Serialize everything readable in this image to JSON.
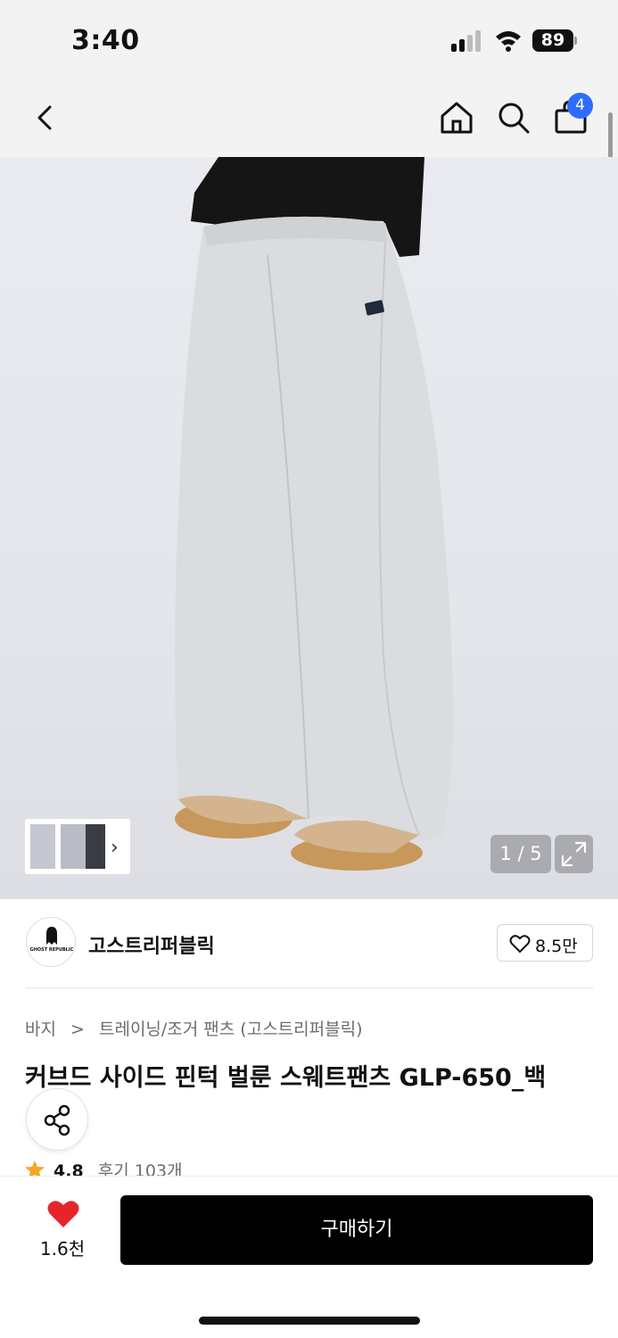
{
  "status_bar": {
    "time": "3:40",
    "battery": "89"
  },
  "nav": {
    "cart_count": "4"
  },
  "gallery": {
    "pager": "1 / 5"
  },
  "brand": {
    "logo_text": "GHOST REPUBLIC",
    "name": "고스트리퍼블릭",
    "likes": "8.5만"
  },
  "breadcrumb": {
    "category": "바지",
    "subcategory": "트레이닝/조거 팬츠 (고스트리퍼블릭)"
  },
  "product": {
    "title": "커브드 사이드 핀턱 벌룬 스웨트팬츠 GLP-650_백"
  },
  "rating": {
    "value": "4.8",
    "reviews": "후기 103개"
  },
  "bottom_bar": {
    "wish_count": "1.6천",
    "buy_label": "구매하기"
  },
  "colors": {
    "accent_blue": "#2f6bff",
    "heart_red": "#e8242b",
    "star": "#f5a623"
  },
  "icons": [
    "back-icon",
    "home-icon",
    "search-icon",
    "cart-icon",
    "expand-icon",
    "heart-outline-icon",
    "share-icon",
    "star-icon",
    "heart-filled-icon"
  ]
}
